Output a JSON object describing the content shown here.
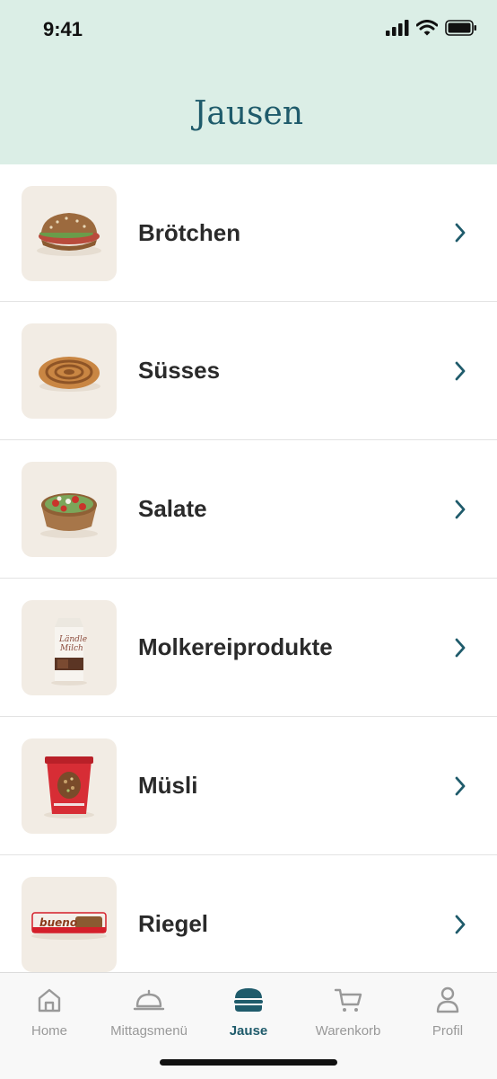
{
  "status_bar": {
    "time": "9:41"
  },
  "header": {
    "title": "Jausen"
  },
  "categories": [
    {
      "label": "Brötchen",
      "icon": "sandwich-image"
    },
    {
      "label": "Süsses",
      "icon": "pastry-image"
    },
    {
      "label": "Salate",
      "icon": "salad-bowl-image"
    },
    {
      "label": "Molkereiprodukte",
      "icon": "milk-carton-image"
    },
    {
      "label": "Müsli",
      "icon": "muesli-cup-image"
    },
    {
      "label": "Riegel",
      "icon": "chocolate-bar-image"
    }
  ],
  "tab_bar": {
    "tabs": [
      {
        "label": "Home",
        "icon": "home-icon",
        "active": false
      },
      {
        "label": "Mittagsmenü",
        "icon": "cloche-icon",
        "active": false
      },
      {
        "label": "Jause",
        "icon": "burger-icon",
        "active": true
      },
      {
        "label": "Warenkorb",
        "icon": "cart-icon",
        "active": false
      },
      {
        "label": "Profil",
        "icon": "person-icon",
        "active": false
      }
    ]
  },
  "colors": {
    "header_bg": "#dbeee6",
    "accent": "#1f5b6b",
    "thumb_bg": "#f2ece4"
  }
}
